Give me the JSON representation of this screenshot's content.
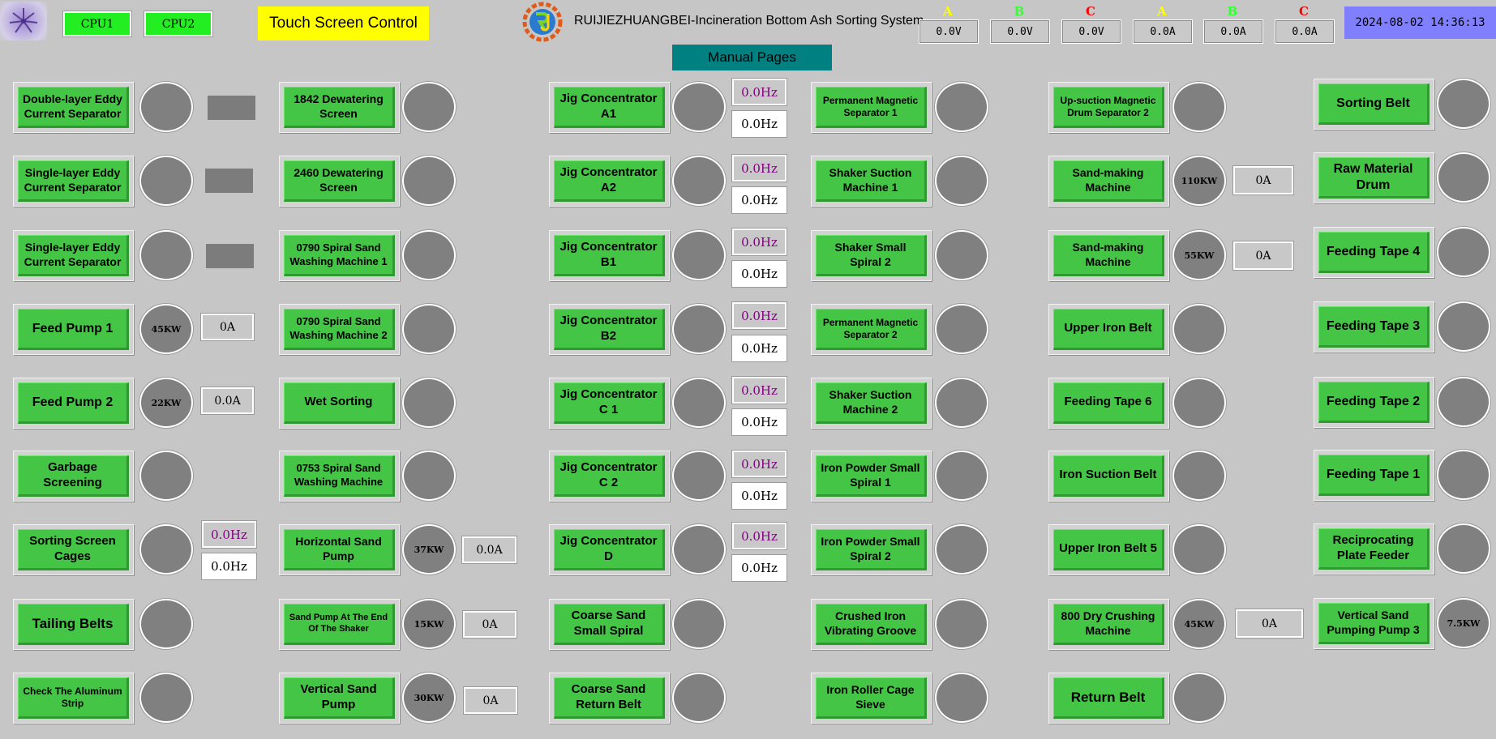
{
  "header": {
    "cpu1": "CPU1",
    "cpu2": "CPU2",
    "touch_label": "Touch Screen Control",
    "system_title": "RUIJIEZHUANGBEI-Incineration Bottom Ash Sorting System",
    "datetime": "2024-08-02 14:36:13",
    "page_label": "Manual Pages",
    "meters": [
      {
        "phase": "A",
        "value": "0.0V",
        "color": "#ffff00"
      },
      {
        "phase": "B",
        "value": "0.0V",
        "color": "#33ff33"
      },
      {
        "phase": "C",
        "value": "0.0V",
        "color": "#ff0000"
      },
      {
        "phase": "A",
        "value": "0.0A",
        "color": "#ffff00"
      },
      {
        "phase": "B",
        "value": "0.0A",
        "color": "#33ff33"
      },
      {
        "phase": "C",
        "value": "0.0A",
        "color": "#ff0000"
      }
    ]
  },
  "col1": {
    "b0": "Double-layer Eddy Current Separator",
    "b1": "Single-layer Eddy Current Separator",
    "b2": "Single-layer Eddy Current Separator",
    "b3": "Feed Pump 1",
    "b4": "Feed Pump  2",
    "b5": "Garbage Screening",
    "b6": "Sorting Screen Cages",
    "b7": "Tailing Belts",
    "b8": "Check The Aluminum Strip",
    "lamp3": "45KW",
    "lamp4": "22KW",
    "cur3": "0A",
    "cur4": "0.0A",
    "hz6a": "0.0Hz",
    "hz6b": "0.0Hz"
  },
  "col2": {
    "b0": "1842 Dewatering Screen",
    "b1": "2460 Dewatering Screen",
    "b2": "0790 Spiral Sand Washing Machine 1",
    "b3": "0790 Spiral Sand Washing Machine 2",
    "b4": "Wet Sorting",
    "b5": "0753 Spiral Sand Washing Machine",
    "b6": "Horizontal Sand Pump",
    "b7": "Sand Pump At The End Of The Shaker",
    "b8": "Vertical Sand Pump",
    "lamp6": "37KW",
    "lamp7": "15KW",
    "lamp8": "30KW",
    "cur6": "0.0A",
    "cur7": "0A",
    "cur8": "0A"
  },
  "col3": {
    "b0": "Jig Concentrator A1",
    "b1": "Jig Concentrator A2",
    "b2": "Jig Concentrator B1",
    "b3": "Jig Concentrator B2",
    "b4": "Jig Concentrator C 1",
    "b5": "Jig Concentrator C 2",
    "b6": "Jig Concentrator D",
    "b7": "Coarse Sand Small Spiral",
    "b8": "Coarse Sand Return Belt",
    "hz": [
      "0.0Hz",
      "0.0Hz",
      "0.0Hz",
      "0.0Hz",
      "0.0Hz",
      "0.0Hz",
      "0.0Hz"
    ],
    "hzw": [
      "0.0Hz",
      "0.0Hz",
      "0.0Hz",
      "0.0Hz",
      "0.0Hz",
      "0.0Hz",
      "0.0Hz"
    ]
  },
  "col4": {
    "b0": "Permanent Magnetic Separator 1",
    "b1": "Shaker Suction Machine 1",
    "b2": "Shaker Small Spiral 2",
    "b3": "Permanent Magnetic Separator 2",
    "b4": "Shaker Suction Machine 2",
    "b5": "Iron Powder Small Spiral 1",
    "b6": "Iron Powder Small Spiral 2",
    "b7": "Crushed Iron Vibrating Groove",
    "b8": "Iron Roller Cage Sieve"
  },
  "col5": {
    "b0": "Up-suction Magnetic Drum Separator 2",
    "b1": "Sand-making Machine",
    "b2": "Sand-making Machine",
    "b3": "Upper Iron Belt",
    "b4": "Feeding Tape 6",
    "b5": "Iron Suction Belt",
    "b6": "Upper Iron Belt 5",
    "b7": "800 Dry Crushing Machine",
    "b8": "Return Belt",
    "lamp1": "110KW",
    "lamp2": "55KW",
    "lamp7": "45KW",
    "cur1": "0A",
    "cur2": "0A",
    "cur7": "0A"
  },
  "col6": {
    "b0": "Sorting Belt",
    "b1": "Raw Material Drum",
    "b2": "Feeding Tape 4",
    "b3": "Feeding Tape 3",
    "b4": "Feeding Tape 2",
    "b5": "Feeding Tape  1",
    "b6": "Reciprocating Plate Feeder",
    "b7": "Vertical Sand Pumping Pump 3",
    "lamp7": "7.5KW"
  }
}
